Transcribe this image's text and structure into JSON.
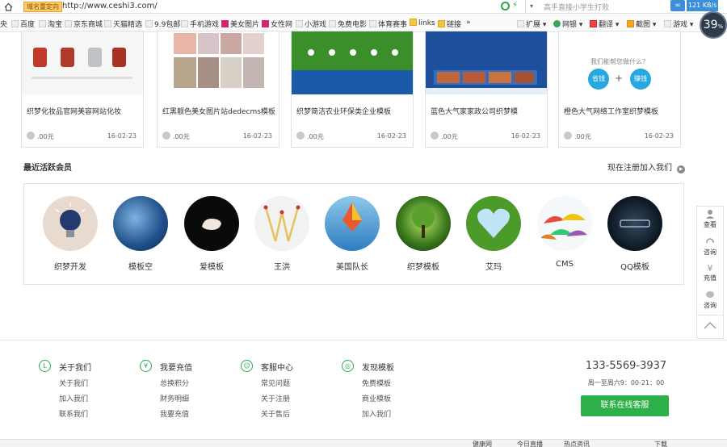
{
  "browser": {
    "url": "http://www.ceshi3.com/",
    "domain_badge": "域名重定向",
    "search_text": "高手直接小学生打败",
    "speed": "121 KB/s",
    "percent_badge": "39",
    "bookmarks": [
      "央",
      "百度",
      "淘宝",
      "京东商城",
      "天猫精选",
      "9.9包邮",
      "手机游戏",
      "美女图片",
      "女性网",
      "小游戏",
      "免费电影",
      "体育赛事",
      "links",
      "链接",
      "»"
    ],
    "toolbar": [
      "扩展",
      "网银",
      "翻译",
      "截图",
      "游戏"
    ]
  },
  "cards": [
    {
      "title": "织梦化妆品官网美容网站化妆",
      "price": ".00元",
      "date": "16-02-23"
    },
    {
      "title": "红黑靓色美女图片站dedecms模板",
      "price": ".00元",
      "date": "16-02-23"
    },
    {
      "title": "织梦简洁农业环保类企业模板",
      "price": ".00元",
      "date": "16-02-23"
    },
    {
      "title": "蓝色大气家家政公司织梦模",
      "price": ".00元",
      "date": "16-02-23"
    },
    {
      "title": "橙色大气网络工作室织梦模板",
      "price": ".00元",
      "date": "16-02-23"
    }
  ],
  "card_thumb_text": {
    "q": "我们能帮您做什么？",
    "b1": "省钱",
    "b2": "赚钱",
    "plus": "+"
  },
  "section": {
    "title": "最近活跃会员",
    "join": "现在注册加入我们"
  },
  "members": [
    "织梦开发",
    "模板空",
    "爱模板",
    "王洪",
    "美国队长",
    "织梦模板",
    "艾玛",
    "CMS",
    "QQ模板"
  ],
  "sidebar": [
    "查看",
    "咨询",
    "充值",
    "咨询"
  ],
  "sidebar_yen": "¥",
  "footer": {
    "cols": [
      {
        "icon": "L",
        "title": "关于我们",
        "links": [
          "关于我们",
          "加入我们",
          "联系我们"
        ]
      },
      {
        "icon": "¥",
        "title": "我要充值",
        "links": [
          "总换积分",
          "财务明细",
          "我要充值"
        ]
      },
      {
        "icon": "☺",
        "title": "客服中心",
        "links": [
          "常见问题",
          "关于注册",
          "关于售后"
        ]
      },
      {
        "icon": "◎",
        "title": "发现模板",
        "links": [
          "免费模板",
          "商业模板",
          "加入我们"
        ]
      }
    ],
    "phone": "133-5569-3937",
    "hours": "周一至周六9：00-21：00",
    "service_btn": "联系在线客服"
  },
  "status_bar": [
    "健康网",
    "今日直播",
    "热点资讯",
    "下载"
  ]
}
